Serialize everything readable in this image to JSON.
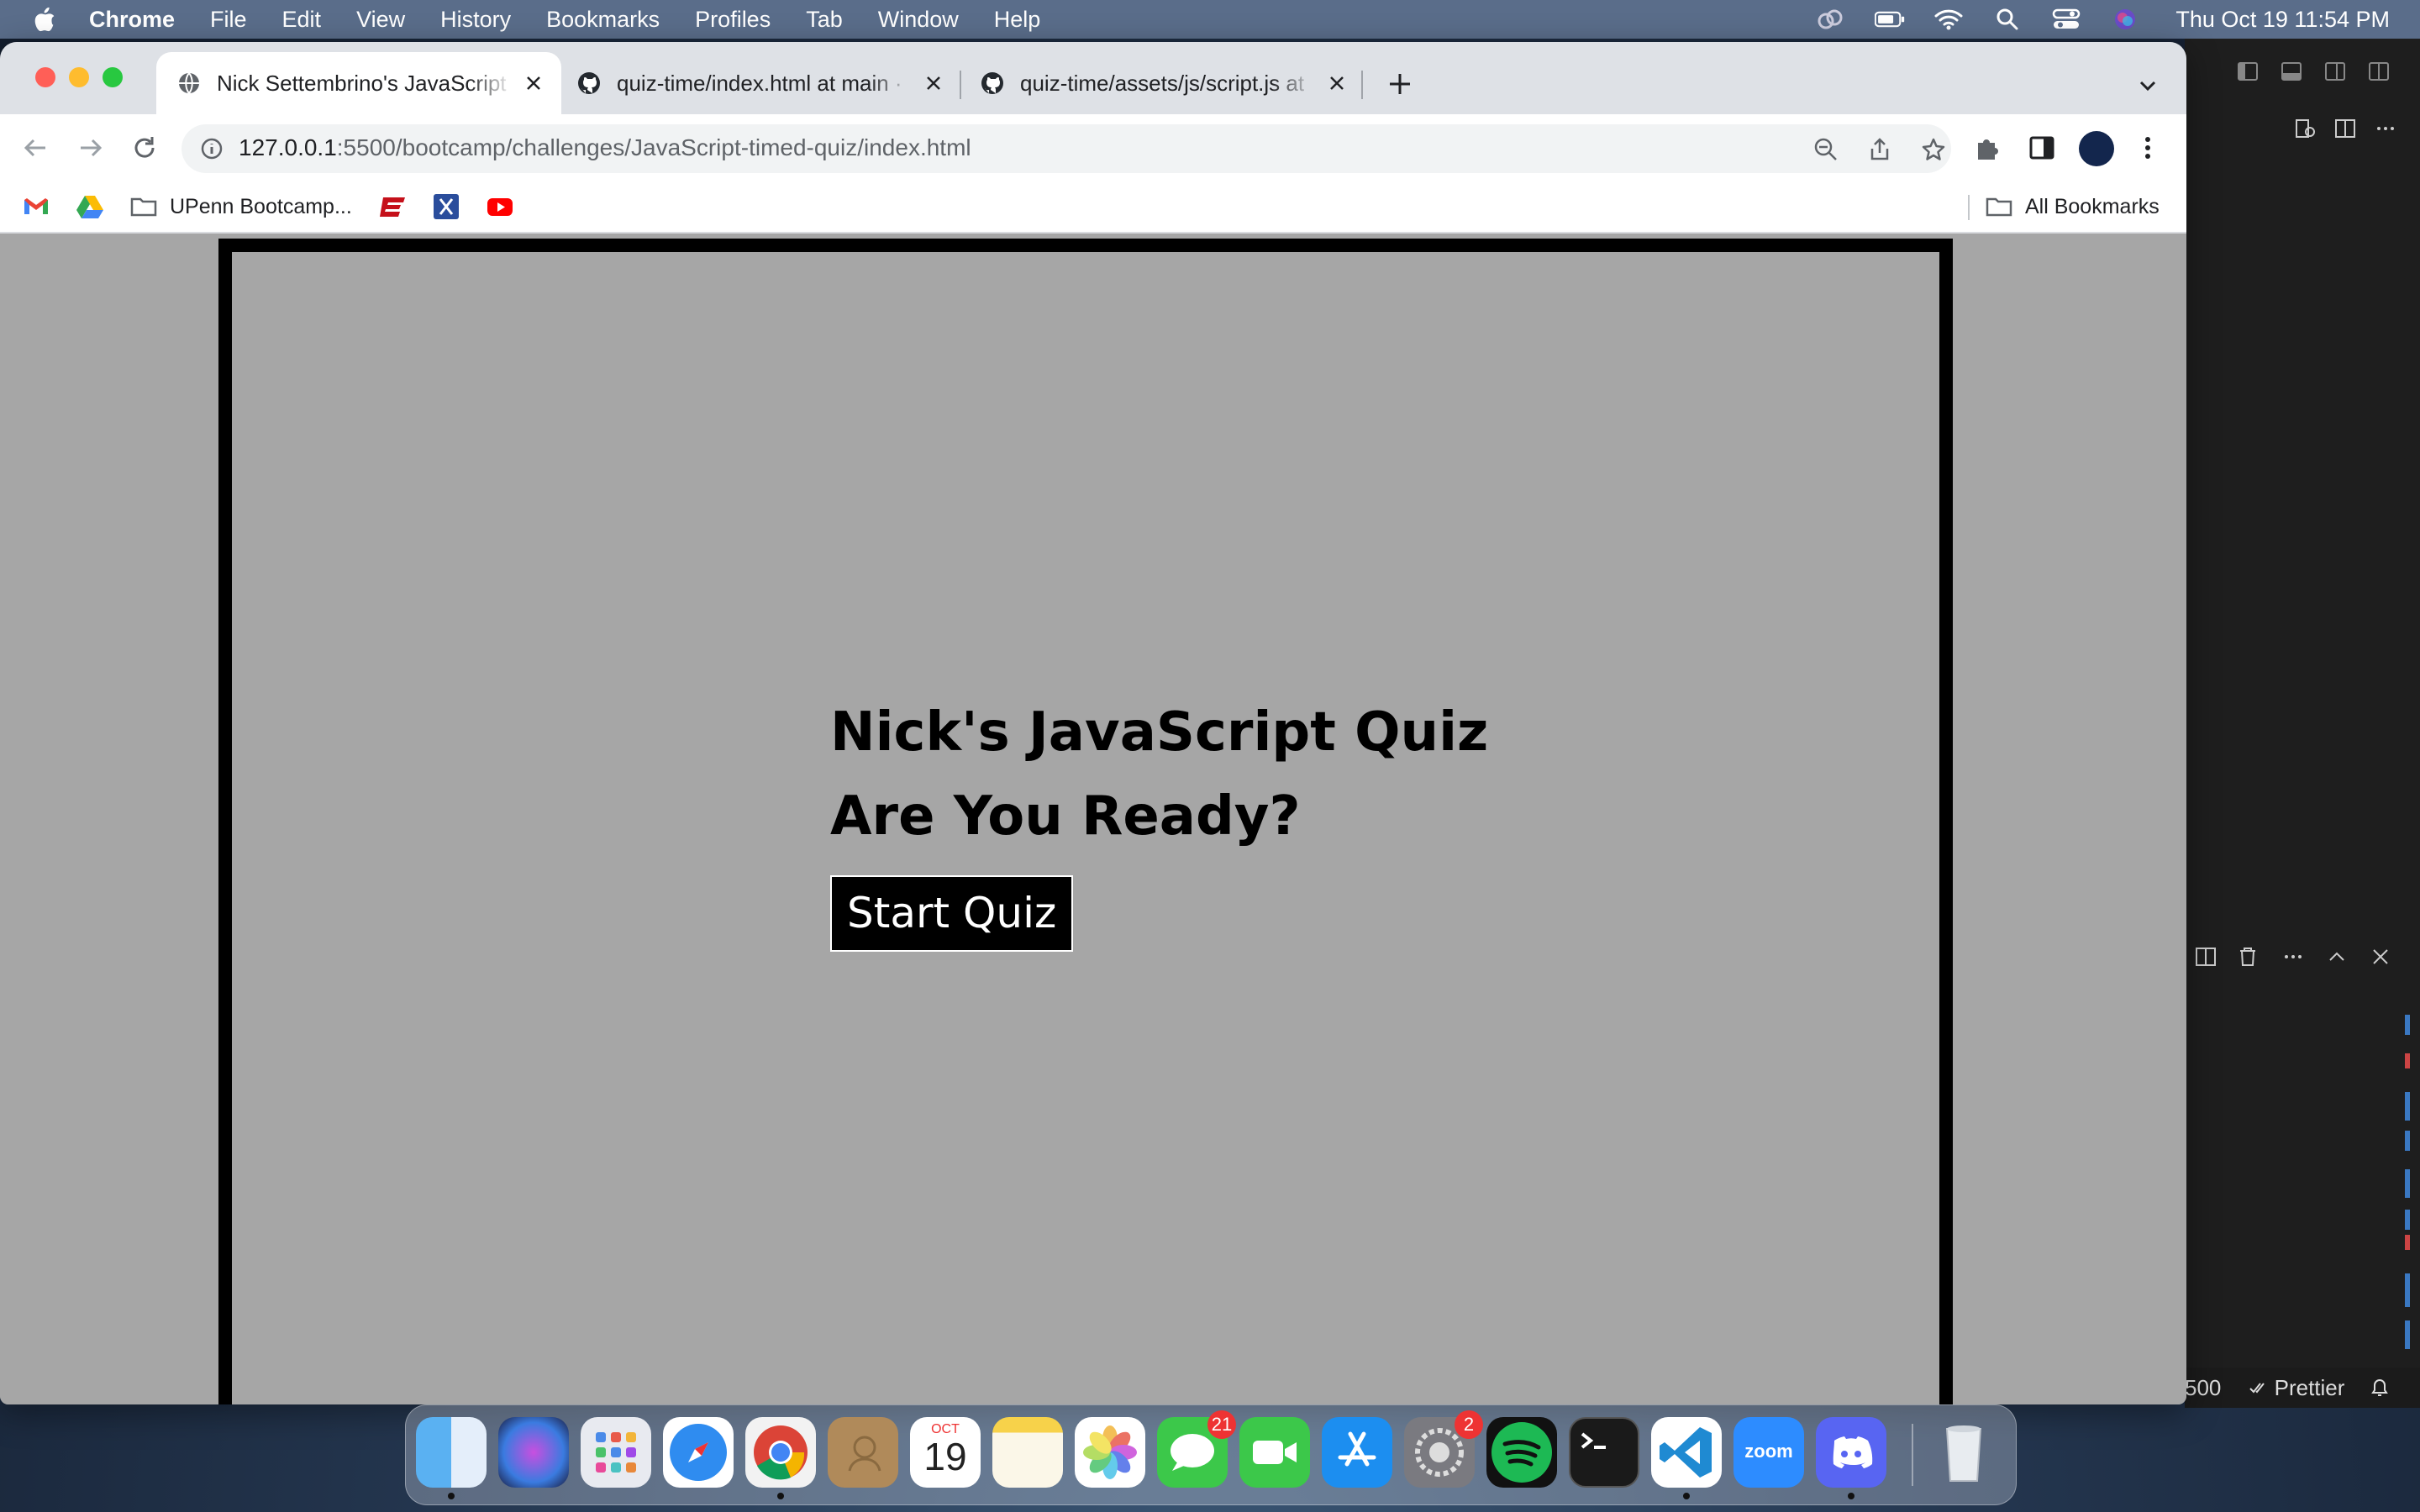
{
  "menubar": {
    "app": "Chrome",
    "items": [
      "File",
      "Edit",
      "View",
      "History",
      "Bookmarks",
      "Profiles",
      "Tab",
      "Window",
      "Help"
    ],
    "clock": "Thu Oct 19  11:54 PM"
  },
  "tabs": [
    {
      "title": "Nick Settembrino's JavaScript",
      "favicon": "globe-icon",
      "active": true
    },
    {
      "title": "quiz-time/index.html at main · ",
      "favicon": "github-icon",
      "active": false
    },
    {
      "title": "quiz-time/assets/js/script.js at",
      "favicon": "github-icon",
      "active": false
    }
  ],
  "omnibox": {
    "host": "127.0.0.1",
    "path": ":5500/bootcamp/challenges/JavaScript-timed-quiz/index.html"
  },
  "bookmarks": {
    "folder_label": "UPenn Bootcamp...",
    "all_label": "All Bookmarks"
  },
  "quiz": {
    "title": "Nick's JavaScript Quiz",
    "subtitle": "Are You Ready?",
    "start_label": "Start Quiz"
  },
  "vscode": {
    "port_fragment": "500",
    "prettier_label": "Prettier"
  },
  "dock": {
    "calendar_month": "OCT",
    "calendar_day": "19",
    "messages_badge": "21",
    "settings_badge": "2",
    "zoom_label": "zoom"
  },
  "colors": {
    "page_bg": "#a6a6a6",
    "quiz_border": "#000000",
    "button_bg": "#000000",
    "button_text": "#ffffff"
  }
}
